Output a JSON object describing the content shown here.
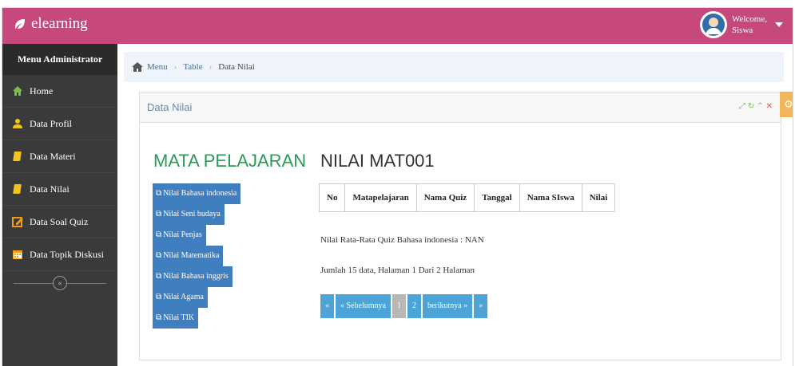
{
  "header": {
    "brand": "elearning",
    "welcome_line1": "Welcome,",
    "welcome_line2": "Siswa"
  },
  "sidebar": {
    "title": "Menu Administrator",
    "items": [
      {
        "label": "Home",
        "icon": "home-icon",
        "color": "#7ac143"
      },
      {
        "label": "Data Profil",
        "icon": "user-icon",
        "color": "#f0c419"
      },
      {
        "label": "Data Materi",
        "icon": "book-icon",
        "color": "#f0c419"
      },
      {
        "label": "Data Nilai",
        "icon": "book-icon",
        "color": "#f0c419"
      },
      {
        "label": "Data Soal Quiz",
        "icon": "edit-icon",
        "color": "#f39c12"
      },
      {
        "label": "Data Topik Diskusi",
        "icon": "calendar-icon",
        "color": "#f39c12"
      }
    ]
  },
  "breadcrumb": {
    "items": [
      "Menu",
      "Table"
    ],
    "current": "Data Nilai"
  },
  "panel": {
    "title": "Data Nilai"
  },
  "content": {
    "subjects_title": "MATA PELAJARAN",
    "subjects": [
      "Nilai Bahasa indonesia",
      "Nilai Seni budaya",
      "Nilai Penjas",
      "Nilai Matematika",
      "Nilai Bahasa inggris",
      "Nilai Agama",
      "Nilai TIK"
    ],
    "nilai_title": "NILAI MAT001",
    "table_headers": [
      "No",
      "Matapelajaran",
      "Nama Quiz",
      "Tanggal",
      "Nama SIswa",
      "Nilai"
    ],
    "average_text": "Nilai Rata-Rata Quiz Bahasa indonesia : NAN",
    "count_text": "Jumlah 15 data, Halaman 1 Dari 2 Halaman",
    "pagination": [
      "«",
      "« Sebelumnya",
      "1",
      "2",
      "berikutnya »",
      "»"
    ],
    "active_page": "1"
  },
  "colors": {
    "topbar": "#c6487c",
    "sidebar": "#3a3a3a",
    "subject_button": "#3f7fc0",
    "pager": "#4ba3d8",
    "title_green": "#2a9a55"
  }
}
